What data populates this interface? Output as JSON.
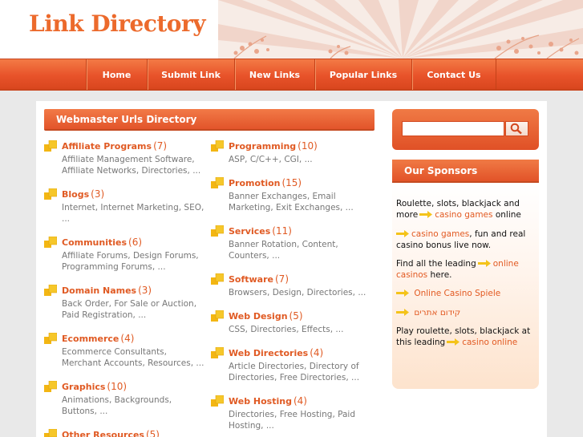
{
  "header": {
    "logo": "Link Directory"
  },
  "nav": {
    "items": [
      {
        "label": "Home"
      },
      {
        "label": "Submit Link"
      },
      {
        "label": "New Links"
      },
      {
        "label": "Popular Links"
      },
      {
        "label": "Contact Us"
      }
    ]
  },
  "main": {
    "section_title": "Webmaster Urls Directory",
    "left_categories": [
      {
        "title": "Affiliate Programs",
        "count": "(7)",
        "desc": "Affiliate Management Software, Affiliate Networks, Directories, ..."
      },
      {
        "title": "Blogs",
        "count": "(3)",
        "desc": "Internet, Internet Marketing, SEO, ..."
      },
      {
        "title": "Communities",
        "count": "(6)",
        "desc": "Affiliate Forums, Design Forums, Programming Forums, ..."
      },
      {
        "title": "Domain Names",
        "count": "(3)",
        "desc": "Back Order, For Sale or Auction, Paid Registration, ..."
      },
      {
        "title": "Ecommerce",
        "count": "(4)",
        "desc": "Ecommerce Consultants, Merchant Accounts, Resources, ..."
      },
      {
        "title": "Graphics",
        "count": "(10)",
        "desc": "Animations, Backgrounds, Buttons, ..."
      },
      {
        "title": "Other Resources",
        "count": "(5)",
        "desc": ""
      }
    ],
    "right_categories": [
      {
        "title": "Programming",
        "count": "(10)",
        "desc": "ASP, C/C++, CGI, ..."
      },
      {
        "title": "Promotion",
        "count": "(15)",
        "desc": "Banner Exchanges, Email Marketing, Exit Exchanges, ..."
      },
      {
        "title": "Services",
        "count": "(11)",
        "desc": "Banner Rotation, Content, Counters, ..."
      },
      {
        "title": "Software",
        "count": "(7)",
        "desc": "Browsers, Design, Directories, ..."
      },
      {
        "title": "Web Design",
        "count": "(5)",
        "desc": "CSS, Directories, Effects, ..."
      },
      {
        "title": "Web Directories",
        "count": "(4)",
        "desc": "Article Directories, Directory of Directories, Free Directories, ..."
      },
      {
        "title": "Web Hosting",
        "count": "(4)",
        "desc": "Directories, Free Hosting, Paid Hosting, ..."
      }
    ]
  },
  "sidebar": {
    "search": {
      "value": "",
      "placeholder": ""
    },
    "sponsors_title": "Our Sponsors",
    "sponsors": [
      {
        "pre": "Roulette, slots, blackjack and more",
        "link": "casino games",
        "post": "online"
      },
      {
        "pre": "",
        "link": "casino games",
        "post": ", fun and real casino bonus live now."
      },
      {
        "pre": "Find all the leading",
        "link": "online casinos",
        "post": "here."
      },
      {
        "pre": "",
        "link": "Online Casino Spiele",
        "post": ""
      },
      {
        "pre": "",
        "link": "קידום אתרים",
        "post": ""
      },
      {
        "pre": "Play roulette, slots, blackjack at this leading",
        "link": "casino online",
        "post": ""
      }
    ]
  },
  "colors": {
    "accent": "#e8532a",
    "link": "#e05a23",
    "icon_yellow": "#f3b613"
  }
}
